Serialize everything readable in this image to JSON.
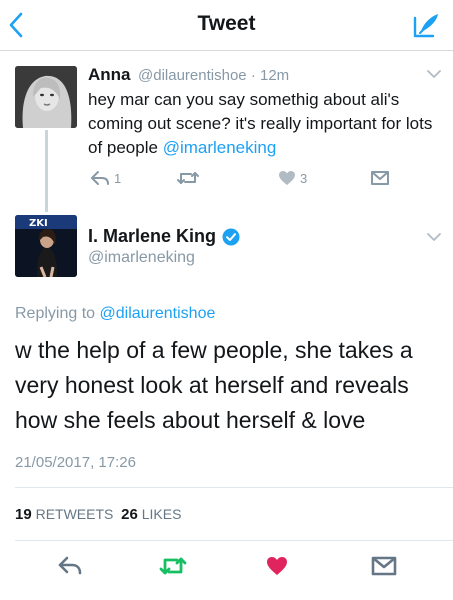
{
  "navbar": {
    "title": "Tweet"
  },
  "tweet1": {
    "name": "Anna",
    "handle": "@dilaurentishoe",
    "separator": "·",
    "time": "12m",
    "text_prefix": "hey mar can you say somethig about ali's coming out scene? it's really important for lots of people ",
    "mention": "@imarleneking",
    "reply_count": "1",
    "retweet_count": "",
    "like_count": "3"
  },
  "tweet2": {
    "name": "I. Marlene King",
    "handle": "@imarleneking",
    "replying_label": "Replying to",
    "replying_handle": "@dilaurentishoe",
    "text": "w the help of a few people, she takes a very honest look at herself and reveals how she feels about herself & love",
    "timestamp": "21/05/2017, 17:26",
    "retweets": "19",
    "retweets_label": "RETWEETS",
    "likes": "26",
    "likes_label": "LIKES"
  },
  "colors": {
    "accent": "#1da1f2",
    "muted": "#8899a6",
    "like_active": "#e0245e",
    "retweet_active": "#17bf63",
    "verified": "#1da1f2"
  },
  "icons": [
    "back-chevron-icon",
    "compose-icon",
    "reply-icon",
    "retweet-icon",
    "heart-icon",
    "direct-message-icon",
    "caret-down-icon",
    "verified-icon"
  ]
}
